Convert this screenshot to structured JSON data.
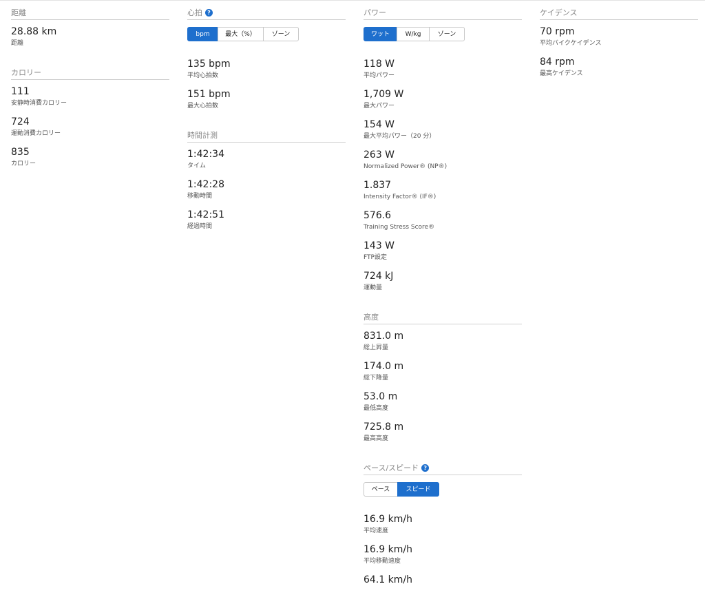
{
  "distance": {
    "title": "距離",
    "stats": [
      {
        "value": "28.88 km",
        "label": "距離"
      }
    ]
  },
  "calories": {
    "title": "カロリー",
    "stats": [
      {
        "value": "111",
        "label": "安静時消費カロリー"
      },
      {
        "value": "724",
        "label": "運動消費カロリー"
      },
      {
        "value": "835",
        "label": "カロリー"
      }
    ]
  },
  "heart_rate": {
    "title": "心拍",
    "buttons": [
      "bpm",
      "最大（%）",
      "ゾーン"
    ],
    "stats": [
      {
        "value": "135 bpm",
        "label": "平均心拍数"
      },
      {
        "value": "151 bpm",
        "label": "最大心拍数"
      }
    ]
  },
  "timing": {
    "title": "時間計測",
    "stats": [
      {
        "value": "1:42:34",
        "label": "タイム"
      },
      {
        "value": "1:42:28",
        "label": "移動時間"
      },
      {
        "value": "1:42:51",
        "label": "経過時間"
      }
    ]
  },
  "power": {
    "title": "パワー",
    "buttons": [
      "ワット",
      "W/kg",
      "ゾーン"
    ],
    "stats": [
      {
        "value": "118 W",
        "label": "平均パワー"
      },
      {
        "value": "1,709 W",
        "label": "最大パワー"
      },
      {
        "value": "154 W",
        "label": "最大平均パワー（20 分）"
      },
      {
        "value": "263 W",
        "label": "Normalized Power® (NP®)"
      },
      {
        "value": "1.837",
        "label": "Intensity Factor® (IF®)"
      },
      {
        "value": "576.6",
        "label": "Training Stress Score®"
      },
      {
        "value": "143 W",
        "label": "FTP設定"
      },
      {
        "value": "724 kJ",
        "label": "運動量"
      }
    ]
  },
  "elevation": {
    "title": "高度",
    "stats": [
      {
        "value": "831.0 m",
        "label": "総上昇量"
      },
      {
        "value": "174.0 m",
        "label": "総下降量"
      },
      {
        "value": "53.0 m",
        "label": "最低高度"
      },
      {
        "value": "725.8 m",
        "label": "最高高度"
      }
    ]
  },
  "pace_speed": {
    "title": "ペース/スピード",
    "buttons": [
      "ペース",
      "スピード"
    ],
    "stats": [
      {
        "value": "16.9 km/h",
        "label": "平均速度"
      },
      {
        "value": "16.9 km/h",
        "label": "平均移動速度"
      },
      {
        "value": "64.1 km/h",
        "label": ""
      }
    ]
  },
  "cadence": {
    "title": "ケイデンス",
    "stats": [
      {
        "value": "70 rpm",
        "label": "平均バイクケイデンス"
      },
      {
        "value": "84 rpm",
        "label": "最高ケイデンス"
      }
    ]
  },
  "help_icon": "question-circle-icon",
  "accent_color": "#1e6fcd"
}
